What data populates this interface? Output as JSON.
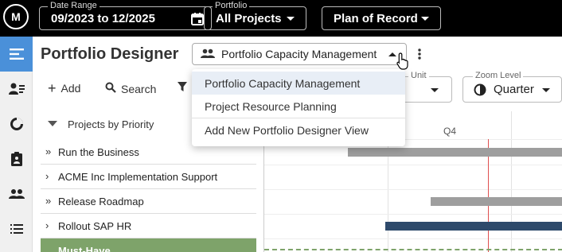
{
  "app": {
    "logo_text": "M"
  },
  "topbar": {
    "date_range": {
      "label": "Date Range",
      "value": "09/2023 to 12/2025"
    },
    "portfolio": {
      "label": "Portfolio",
      "value": "All Projects"
    },
    "plan": {
      "value": "Plan of Record"
    }
  },
  "header": {
    "title": "Portfolio Designer",
    "view_select_value": "Portfolio Capacity Management"
  },
  "toolbar": {
    "add_label": "Add",
    "search_label": "Search",
    "time_unit": {
      "label_partial": "Unit",
      "value": ""
    },
    "zoom": {
      "label": "Zoom Level",
      "value": "Quarter"
    }
  },
  "menu": {
    "items": [
      "Portfolio Capacity Management",
      "Project Resource Planning",
      "Add New Portfolio Designer View"
    ]
  },
  "list": {
    "group_label": "Projects by Priority",
    "rows": [
      {
        "label": "Run the Business"
      },
      {
        "label": "ACME Inc Implementation Support"
      },
      {
        "label": "Release Roadmap"
      },
      {
        "label": "Rollout SAP HR"
      },
      {
        "label": "Must-Have"
      }
    ]
  },
  "gantt": {
    "quarter_label": "Q4"
  },
  "colors": {
    "accent": "#4a90d9",
    "must_have_green": "#7ea36a",
    "bar_gray": "#9e9e9e",
    "bar_navy": "#2e4a6b",
    "today_line": "#e05050"
  },
  "icons": [
    "calendar-icon",
    "people-icon",
    "more-vert-icon",
    "menu-icon",
    "assign-icon",
    "pie-icon",
    "clipboard-icon",
    "group-icon",
    "list-icon",
    "search-icon",
    "filter-icon",
    "pointer-cursor-icon",
    "time-icon"
  ]
}
